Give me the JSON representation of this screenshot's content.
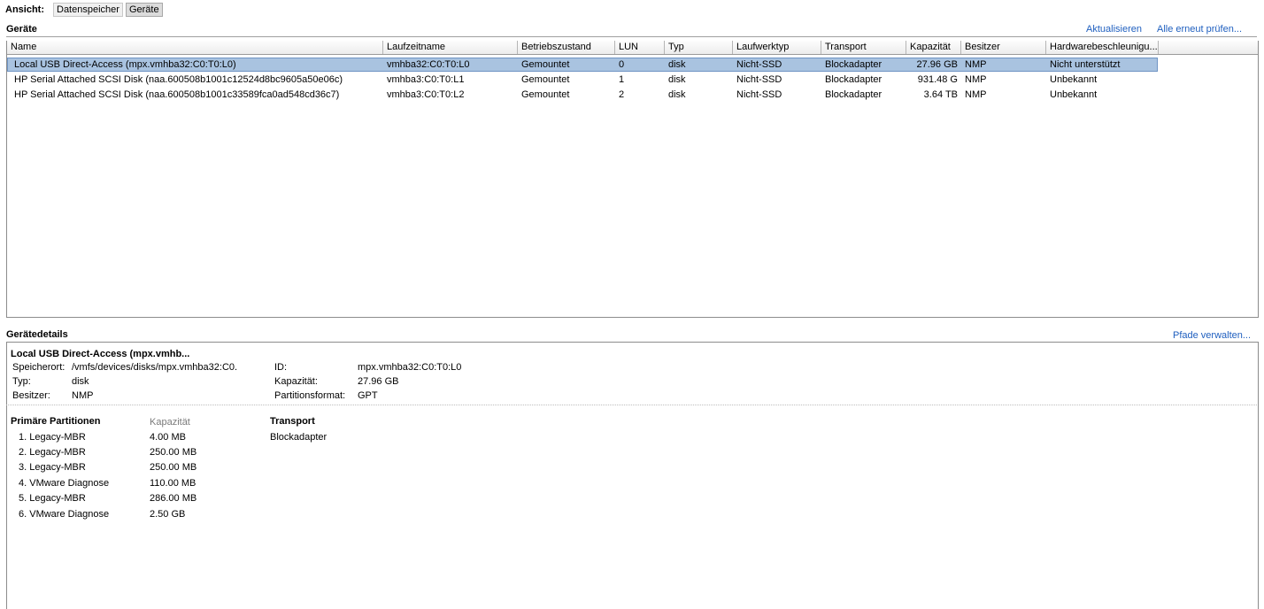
{
  "view": {
    "label": "Ansicht:",
    "buttons": [
      "Datenspeicher",
      "Geräte"
    ],
    "active": "Geräte"
  },
  "devices": {
    "title": "Geräte",
    "actions": {
      "refresh": "Aktualisieren",
      "rescan": "Alle erneut prüfen..."
    },
    "columns": [
      "Name",
      "Laufzeitname",
      "Betriebszustand",
      "LUN",
      "Typ",
      "Laufwerktyp",
      "Transport",
      "Kapazität",
      "Besitzer",
      "Hardwarebeschleunigu..."
    ],
    "rows": [
      [
        "Local USB Direct-Access (mpx.vmhba32:C0:T0:L0)",
        "vmhba32:C0:T0:L0",
        "Gemountet",
        "0",
        "disk",
        "Nicht-SSD",
        "Blockadapter",
        "27.96 GB",
        "NMP",
        "Nicht unterstützt"
      ],
      [
        "HP Serial Attached SCSI Disk (naa.600508b1001c12524d8bc9605a50e06c)",
        "vmhba3:C0:T0:L1",
        "Gemountet",
        "1",
        "disk",
        "Nicht-SSD",
        "Blockadapter",
        "931.48 G",
        "NMP",
        "Unbekannt"
      ],
      [
        "HP Serial Attached SCSI Disk (naa.600508b1001c33589fca0ad548cd36c7)",
        "vmhba3:C0:T0:L2",
        "Gemountet",
        "2",
        "disk",
        "Nicht-SSD",
        "Blockadapter",
        "3.64 TB",
        "NMP",
        "Unbekannt"
      ]
    ],
    "selected_row": 0
  },
  "details": {
    "title": "Gerätedetails",
    "manage_paths": "Pfade verwalten...",
    "device_name": "Local USB Direct-Access (mpx.vmhb...",
    "left": [
      {
        "key": "Speicherort:",
        "value": "/vmfs/devices/disks/mpx.vmhba32:C0."
      },
      {
        "key": "Typ:",
        "value": "disk"
      },
      {
        "key": "Besitzer:",
        "value": "NMP"
      }
    ],
    "right": [
      {
        "key": "ID:",
        "value": "mpx.vmhba32:C0:T0:L0"
      },
      {
        "key": "Kapazität:",
        "value": "27.96 GB"
      },
      {
        "key": "Partitionsformat:",
        "value": "GPT"
      }
    ],
    "partitions_header": "Primäre Partitionen",
    "capacity_header": "Kapazität",
    "transport_header": "Transport",
    "transport_value": "Blockadapter",
    "partitions": [
      {
        "name": "1. Legacy-MBR",
        "size": "4.00 MB"
      },
      {
        "name": "2. Legacy-MBR",
        "size": "250.00 MB"
      },
      {
        "name": "3. Legacy-MBR",
        "size": "250.00 MB"
      },
      {
        "name": "4. VMware Diagnose",
        "size": "110.00 MB"
      },
      {
        "name": "5. Legacy-MBR",
        "size": "286.00 MB"
      },
      {
        "name": "6. VMware Diagnose",
        "size": "2.50 GB"
      }
    ]
  }
}
